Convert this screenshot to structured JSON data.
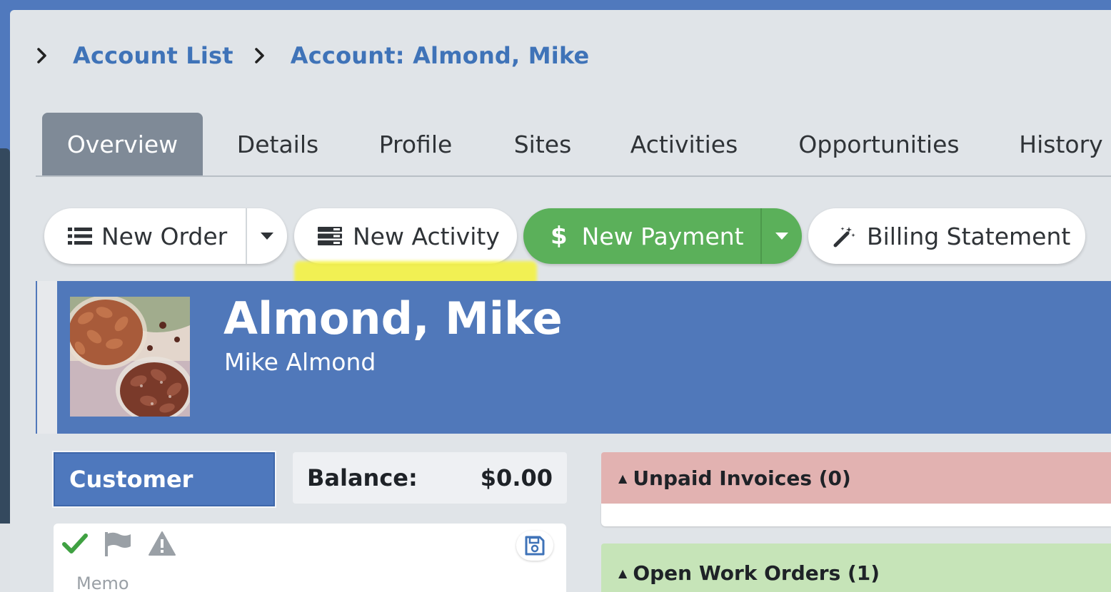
{
  "breadcrumb": {
    "items": [
      "Account List",
      "Account: Almond, Mike"
    ]
  },
  "tabs": [
    "Overview",
    "Details",
    "Profile",
    "Sites",
    "Activities",
    "Opportunities",
    "History"
  ],
  "active_tab": "Overview",
  "actions": {
    "new_order": "New Order",
    "new_activity": "New Activity",
    "new_payment": "New Payment",
    "billing_statement": "Billing Statement"
  },
  "account": {
    "name": "Almond, Mike",
    "contact": "Mike Almond",
    "type": "Customer",
    "balance_label": "Balance:",
    "balance_value": "$0.00"
  },
  "memo": {
    "label": "Memo"
  },
  "panels": {
    "unpaid_invoices": "Unpaid Invoices (0)",
    "open_work_orders": "Open Work Orders (1)"
  },
  "colors": {
    "accent_blue": "#5078ba",
    "link_blue": "#3f73b8",
    "payment_green": "#5bb05a",
    "unpaid_red": "#e2b2b1",
    "work_green": "#c6e4b8"
  }
}
